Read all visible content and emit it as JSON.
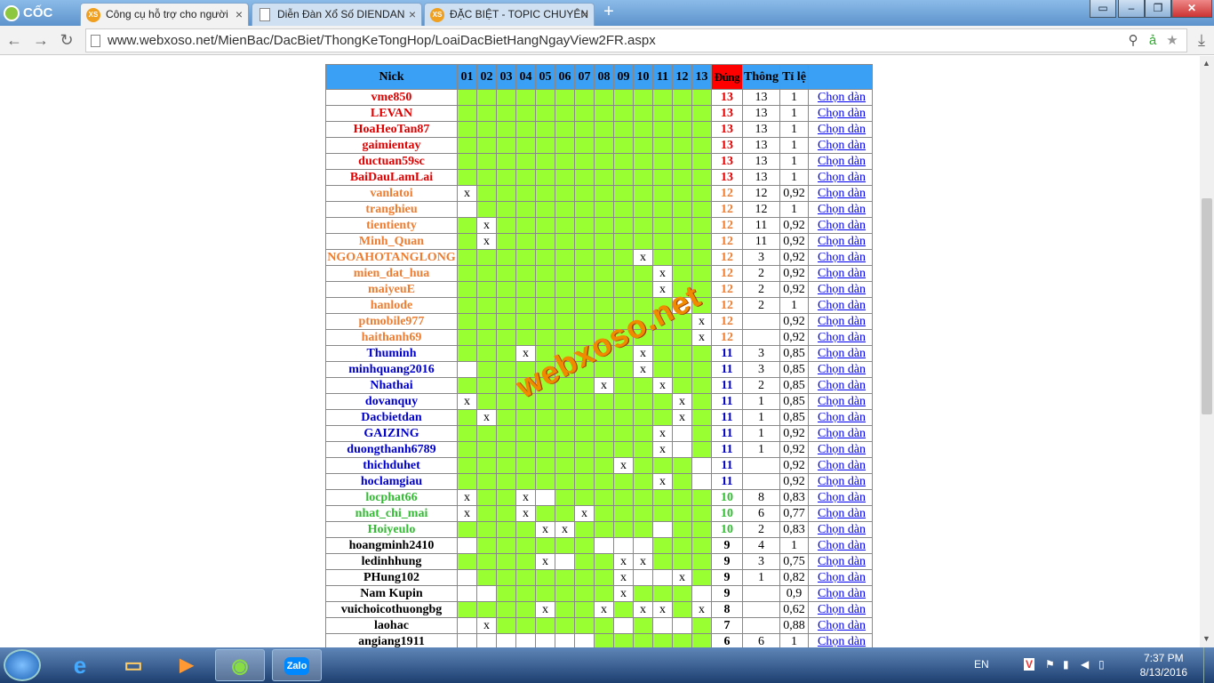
{
  "browser": {
    "brand": "CỐC CỐC",
    "tabs": [
      {
        "label": "Công cụ hỗ trợ cho người",
        "icon": "XS",
        "active": true
      },
      {
        "label": "Diễn Đàn Xổ Số DIENDAN",
        "icon": "page",
        "active": false
      },
      {
        "label": "ĐẶC BIỆT - TOPIC CHUYÊN",
        "icon": "XS",
        "active": false
      }
    ],
    "url": "www.webxoso.net/MienBac/DacBiet/ThongKeTongHop/LoaiDacBietHangNgayView2FR.aspx"
  },
  "table": {
    "headers": {
      "nick": "Nick",
      "nums": [
        "01",
        "02",
        "03",
        "04",
        "05",
        "06",
        "07",
        "08",
        "09",
        "10",
        "11",
        "12",
        "13"
      ],
      "dung": "Đúng",
      "thong": "Thông",
      "tile": "Tỉ lệ"
    },
    "link_label": "Chọn dàn",
    "rows": [
      {
        "nick": "vme850",
        "level": 13,
        "x": [],
        "w": [],
        "dung": "13",
        "thong": "13",
        "tile": "1"
      },
      {
        "nick": "LEVAN",
        "level": 13,
        "x": [],
        "w": [],
        "dung": "13",
        "thong": "13",
        "tile": "1"
      },
      {
        "nick": "HoaHeoTan87",
        "level": 13,
        "x": [],
        "w": [],
        "dung": "13",
        "thong": "13",
        "tile": "1"
      },
      {
        "nick": "gaimientay",
        "level": 13,
        "x": [],
        "w": [],
        "dung": "13",
        "thong": "13",
        "tile": "1"
      },
      {
        "nick": "ductuan59sc",
        "level": 13,
        "x": [],
        "w": [],
        "dung": "13",
        "thong": "13",
        "tile": "1"
      },
      {
        "nick": "BaiDauLamLai",
        "level": 13,
        "x": [],
        "w": [],
        "dung": "13",
        "thong": "13",
        "tile": "1"
      },
      {
        "nick": "vanlatoi",
        "level": 12,
        "x": [
          1
        ],
        "w": [],
        "dung": "12",
        "thong": "12",
        "tile": "0,92"
      },
      {
        "nick": "tranghieu",
        "level": 12,
        "x": [],
        "w": [
          1
        ],
        "dung": "12",
        "thong": "12",
        "tile": "1"
      },
      {
        "nick": "tientienty",
        "level": 12,
        "x": [
          2
        ],
        "w": [],
        "dung": "12",
        "thong": "11",
        "tile": "0,92"
      },
      {
        "nick": "Minh_Quan",
        "level": 12,
        "x": [
          2
        ],
        "w": [],
        "dung": "12",
        "thong": "11",
        "tile": "0,92"
      },
      {
        "nick": "NGOAHOTANGLONG",
        "level": 12,
        "x": [
          10
        ],
        "w": [],
        "dung": "12",
        "thong": "3",
        "tile": "0,92"
      },
      {
        "nick": "mien_dat_hua",
        "level": 12,
        "x": [
          11
        ],
        "w": [],
        "dung": "12",
        "thong": "2",
        "tile": "0,92"
      },
      {
        "nick": "maiyeuE",
        "level": 12,
        "x": [
          11
        ],
        "w": [],
        "dung": "12",
        "thong": "2",
        "tile": "0,92"
      },
      {
        "nick": "hanlode",
        "level": 12,
        "x": [],
        "w": [
          12
        ],
        "dung": "12",
        "thong": "2",
        "tile": "1"
      },
      {
        "nick": "ptmobile977",
        "level": 12,
        "x": [
          13
        ],
        "w": [],
        "dung": "12",
        "thong": "",
        "tile": "0,92"
      },
      {
        "nick": "haithanh69",
        "level": 12,
        "x": [
          13
        ],
        "w": [],
        "dung": "12",
        "thong": "",
        "tile": "0,92"
      },
      {
        "nick": "Thuminh",
        "level": 11,
        "x": [
          4,
          10
        ],
        "w": [],
        "dung": "11",
        "thong": "3",
        "tile": "0,85"
      },
      {
        "nick": "minhquang2016",
        "level": 11,
        "x": [
          10
        ],
        "w": [
          1
        ],
        "dung": "11",
        "thong": "3",
        "tile": "0,85"
      },
      {
        "nick": "Nhathai",
        "level": 11,
        "x": [
          8,
          11
        ],
        "w": [],
        "dung": "11",
        "thong": "2",
        "tile": "0,85"
      },
      {
        "nick": "dovanquy",
        "level": 11,
        "x": [
          1,
          12
        ],
        "w": [],
        "dung": "11",
        "thong": "1",
        "tile": "0,85"
      },
      {
        "nick": "Dacbietdan",
        "level": 11,
        "x": [
          2,
          12
        ],
        "w": [],
        "dung": "11",
        "thong": "1",
        "tile": "0,85"
      },
      {
        "nick": "GAIZING",
        "level": 11,
        "x": [
          11
        ],
        "w": [
          12
        ],
        "dung": "11",
        "thong": "1",
        "tile": "0,92"
      },
      {
        "nick": "duongthanh6789",
        "level": 11,
        "x": [
          11
        ],
        "w": [
          12
        ],
        "dung": "11",
        "thong": "1",
        "tile": "0,92"
      },
      {
        "nick": "thichduhet",
        "level": 11,
        "x": [
          9
        ],
        "w": [
          13
        ],
        "dung": "11",
        "thong": "",
        "tile": "0,92"
      },
      {
        "nick": "hoclamgiau",
        "level": 11,
        "x": [
          11
        ],
        "w": [
          13
        ],
        "dung": "11",
        "thong": "",
        "tile": "0,92"
      },
      {
        "nick": "locphat66",
        "level": 10,
        "x": [
          1,
          4
        ],
        "w": [
          5
        ],
        "dung": "10",
        "thong": "8",
        "tile": "0,83"
      },
      {
        "nick": "nhat_chi_mai",
        "level": 10,
        "x": [
          1,
          4,
          7
        ],
        "w": [],
        "dung": "10",
        "thong": "6",
        "tile": "0,77"
      },
      {
        "nick": "Hoiyeulo",
        "level": 10,
        "x": [
          5,
          6
        ],
        "w": [
          11
        ],
        "dung": "10",
        "thong": "2",
        "tile": "0,83"
      },
      {
        "nick": "hoangminh2410",
        "level": 9,
        "x": [],
        "w": [
          1,
          8,
          9,
          10
        ],
        "dung": "9",
        "thong": "4",
        "tile": "1"
      },
      {
        "nick": "ledinhhung",
        "level": 9,
        "x": [
          5,
          9,
          10
        ],
        "w": [
          6
        ],
        "dung": "9",
        "thong": "3",
        "tile": "0,75"
      },
      {
        "nick": "PHung102",
        "level": 9,
        "x": [
          9,
          12
        ],
        "w": [
          1,
          10,
          11
        ],
        "dung": "9",
        "thong": "1",
        "tile": "0,82"
      },
      {
        "nick": "Nam Kupin",
        "level": 9,
        "x": [
          9
        ],
        "w": [
          1,
          2,
          13
        ],
        "dung": "9",
        "thong": "",
        "tile": "0,9"
      },
      {
        "nick": "vuichoicothuongbg",
        "level": 9,
        "x": [
          5,
          8,
          10,
          11,
          13
        ],
        "w": [],
        "dung": "8",
        "thong": "",
        "tile": "0,62"
      },
      {
        "nick": "laohac",
        "level": 9,
        "x": [
          2
        ],
        "w": [
          1,
          9,
          11,
          12
        ],
        "dung": "7",
        "thong": "",
        "tile": "0,88"
      },
      {
        "nick": "angiang1911",
        "level": 9,
        "x": [],
        "w": [
          1,
          2,
          3,
          4,
          5,
          6,
          7
        ],
        "dung": "6",
        "thong": "6",
        "tile": "1"
      }
    ]
  },
  "watermark": "webxoso.net",
  "taskbar": {
    "apps": [
      "ie",
      "explorer",
      "media",
      "coccoc",
      "Zalo"
    ],
    "lang": "EN",
    "time": "7:37 PM",
    "date": "8/13/2016"
  }
}
